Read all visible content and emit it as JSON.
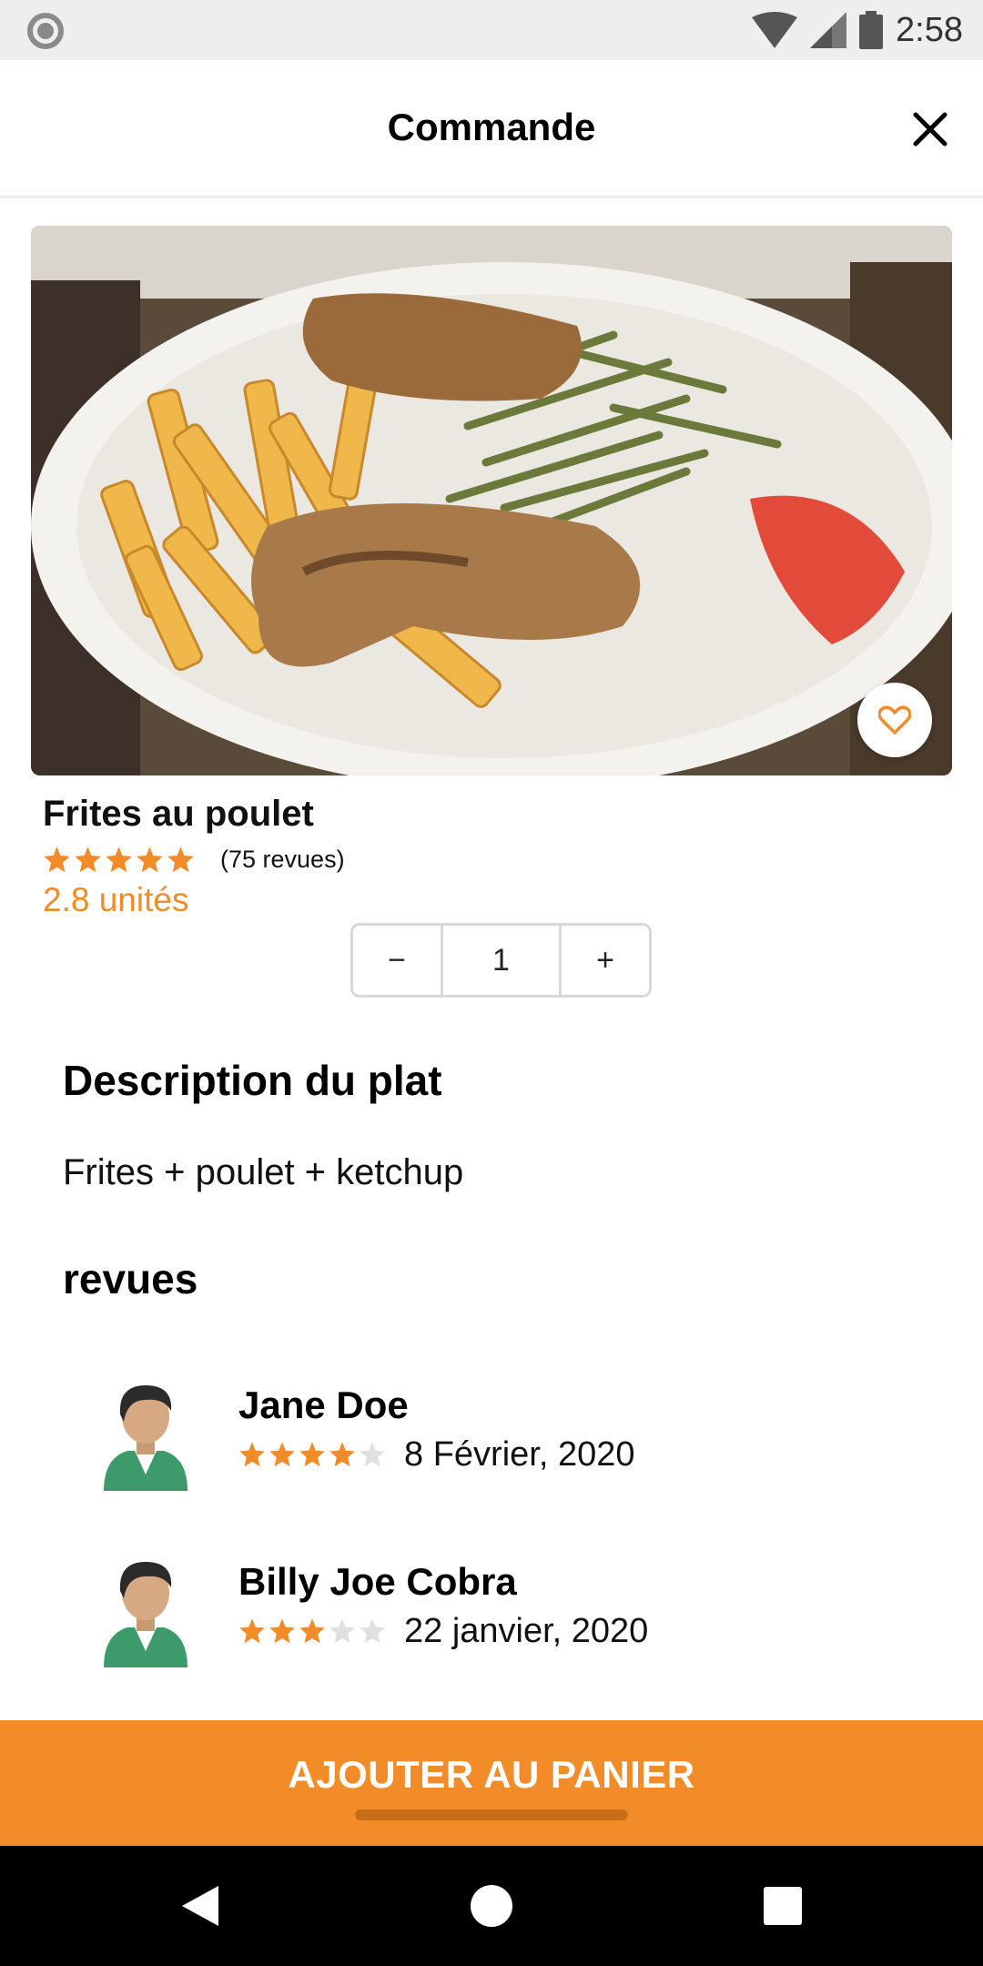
{
  "status_bar": {
    "time": "2:58"
  },
  "header": {
    "title": "Commande"
  },
  "product": {
    "image_icon": "food-photo",
    "name": "Frites au poulet",
    "rating": 5,
    "review_count": "(75 revues)",
    "price": "2.8 unités",
    "quantity": "1",
    "minus_label": "−",
    "plus_label": "+"
  },
  "description": {
    "title": "Description du plat",
    "text": "Frites + poulet + ketchup"
  },
  "reviews": {
    "title": "revues",
    "items": [
      {
        "name": "Jane Doe",
        "rating": 4,
        "date": "8 Février, 2020"
      },
      {
        "name": "Billy Joe Cobra",
        "rating": 3,
        "date": "22 janvier, 2020"
      }
    ]
  },
  "cart": {
    "label": "AJOUTER AU PANIER"
  },
  "colors": {
    "accent": "#f28c28",
    "star_empty": "#e0e0e0"
  }
}
